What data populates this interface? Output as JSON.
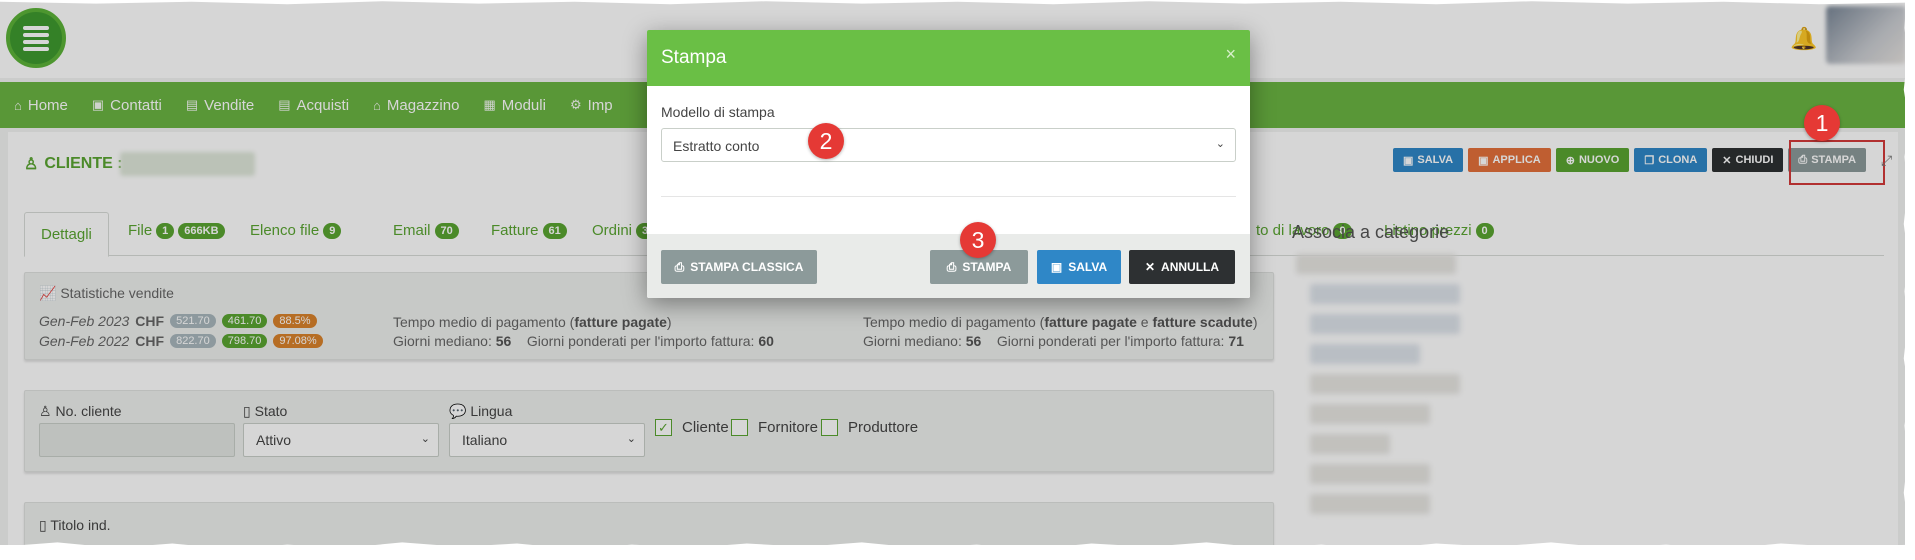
{
  "nav": {
    "items": [
      {
        "label": "Home",
        "icon": "home-icon"
      },
      {
        "label": "Contatti",
        "icon": "contacts-icon"
      },
      {
        "label": "Vendite",
        "icon": "sales-icon"
      },
      {
        "label": "Acquisti",
        "icon": "purchases-icon"
      },
      {
        "label": "Magazzino",
        "icon": "warehouse-icon"
      },
      {
        "label": "Moduli",
        "icon": "modules-icon"
      },
      {
        "label": "Imp",
        "icon": "settings-icon"
      }
    ]
  },
  "client": {
    "title": "CLIENTE :"
  },
  "actions": {
    "salva": "SALVA",
    "applica": "APPLICA",
    "nuovo": "NUOVO",
    "clona": "CLONA",
    "chiudi": "CHIUDI",
    "stampa": "STAMPA"
  },
  "colors": {
    "primary_green": "#6ab442",
    "blue": "#2f87c7",
    "orange": "#e4713b",
    "green_btn": "#5aa532",
    "dark": "#2d3032",
    "grey_btn": "#8c9a9a",
    "marker_red": "#e53935"
  },
  "tabs": [
    {
      "label": "Dettagli"
    },
    {
      "label": "File",
      "badges": [
        "1",
        "666KB"
      ]
    },
    {
      "label": "Elenco file",
      "badges": [
        "9"
      ]
    },
    {
      "label": "Email",
      "badges": [
        "70"
      ]
    },
    {
      "label": "Fatture",
      "badges": [
        "61"
      ]
    },
    {
      "label": "Ordini",
      "badges": [
        "3"
      ]
    },
    {
      "label": "to di lavoro",
      "badges": [
        "0"
      ]
    },
    {
      "label": "Listino prezzi",
      "badges": [
        "0"
      ]
    }
  ],
  "stats": {
    "title": "Statistiche vendite",
    "rows": [
      {
        "period": "Gen-Feb 2023",
        "currency": "CHF",
        "v1": "521.70",
        "v2": "461.70",
        "pct": "88.5%"
      },
      {
        "period": "Gen-Feb 2022",
        "currency": "CHF",
        "v1": "822.70",
        "v2": "798.70",
        "pct": "97.08%"
      }
    ],
    "info1": {
      "prefix": "Tempo medio di pagamento (",
      "bold1": "fatture pagate",
      "suffix": ")",
      "median_label": "Giorni mediano:",
      "median": "56",
      "weighted_label": "Giorni ponderati per l'importo fattura:",
      "weighted": "60"
    },
    "info2": {
      "prefix": "Tempo medio di pagamento (",
      "bold1": "fatture pagate",
      "mid": " e ",
      "bold2": "fatture scadute",
      "suffix": ")",
      "median_label": "Giorni mediano:",
      "median": "56",
      "weighted_label": "Giorni ponderati per l'importo fattura:",
      "weighted": "71"
    }
  },
  "form": {
    "no_cliente_label": "No. cliente",
    "stato_label": "Stato",
    "stato_value": "Attivo",
    "lingua_label": "Lingua",
    "lingua_value": "Italiano",
    "cliente": "Cliente",
    "fornitore": "Fornitore",
    "produttore": "Produttore",
    "titolo_label": "Titolo ind."
  },
  "assoc": {
    "title": "Associa a categorie"
  },
  "modal": {
    "title": "Stampa",
    "close": "×",
    "label": "Modello di stampa",
    "value": "Estratto conto",
    "btn_classica": "STAMPA CLASSICA",
    "btn_stampa": "STAMPA",
    "btn_salva": "SALVA",
    "btn_annulla": "ANNULLA"
  },
  "markers": [
    "1",
    "2",
    "3"
  ]
}
